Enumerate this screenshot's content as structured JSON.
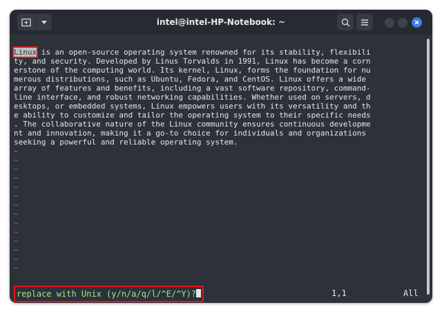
{
  "window": {
    "title": "intel@intel-HP-Notebook: ~"
  },
  "icons": {
    "new_tab": "new-tab-icon",
    "dropdown": "chevron-down-icon",
    "search": "search-icon",
    "menu": "hamburger-icon",
    "minimize": "minimize-icon",
    "maximize": "maximize-icon",
    "close": "close-icon"
  },
  "colors": {
    "terminal_bg": "#2d3139",
    "text": "#e6e6e6",
    "prompt_text": "#a7e08d",
    "tilde": "#6d7fa8",
    "highlight_box": "#e3131b",
    "close_button": "#3b7de4"
  },
  "editor": {
    "highlighted_word": "Linux",
    "lines": [
      " is an open-source operating system renowned for its stability, flexibili",
      "ty, and security. Developed by Linus Torvalds in 1991, Linux has become a corn",
      "erstone of the computing world. Its kernel, Linux, forms the foundation for nu",
      "merous distributions, such as Ubuntu, Fedora, and CentOS. Linux offers a wide",
      "array of features and benefits, including a vast software repository, command-",
      "line interface, and robust networking capabilities. Whether used on servers, d",
      "esktops, or embedded systems, Linux empowers users with its versatility and th",
      "e ability to customize and tailor the operating system to their specific needs",
      ". The collaborative nature of the Linux community ensures continuous developme",
      "nt and innovation, making it a go-to choice for individuals and organizations",
      "seeking a powerful and reliable operating system."
    ],
    "tilde_lines": [
      "~",
      "~",
      "~",
      "~",
      "~",
      "~",
      "~",
      "~",
      "~",
      "~",
      "~",
      "~",
      "~",
      "~"
    ]
  },
  "status": {
    "prompt": "replace with Unix (y/n/a/q/l/^E/^Y)?",
    "position": "1,1",
    "scroll": "All"
  }
}
